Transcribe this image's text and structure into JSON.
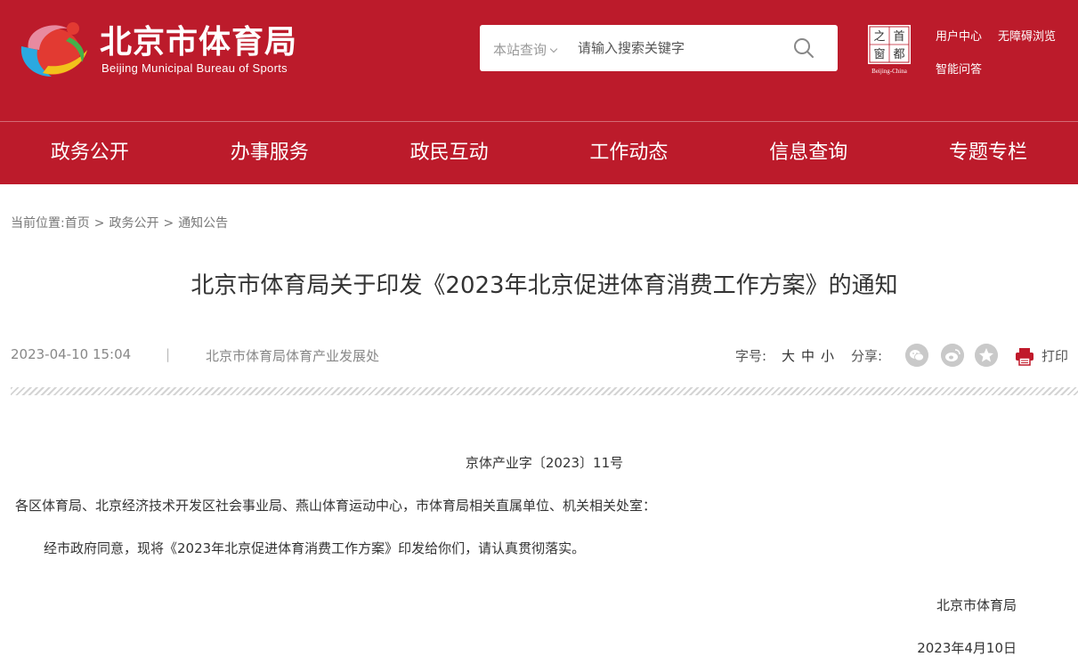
{
  "header": {
    "site_name": "北京市体育局",
    "site_name_en": "Beijing Municipal Bureau of Sports",
    "search": {
      "scope": "本站查询",
      "placeholder": "请输入搜索关键字"
    },
    "capital_window": {
      "chars": [
        "首",
        "都",
        "之",
        "窗"
      ],
      "subtitle": "Beijing-China"
    },
    "links": {
      "user_center": "用户中心",
      "accessibility": "无障碍浏览",
      "smart_qa": "智能问答"
    }
  },
  "nav": {
    "items": [
      "政务公开",
      "办事服务",
      "政民互动",
      "工作动态",
      "信息查询",
      "专题专栏"
    ]
  },
  "breadcrumb": {
    "prefix": "当前位置:",
    "items": [
      "首页",
      "政务公开",
      "通知公告"
    ],
    "separator": ">"
  },
  "article": {
    "title": "北京市体育局关于印发《2023年北京促进体育消费工作方案》的通知",
    "date": "2023-04-10 15:04",
    "divider": "|",
    "department": "北京市体育局体育产业发展处",
    "font_size_label": "字号:",
    "font_sizes": [
      "大",
      "中",
      "小"
    ],
    "share_label": "分享:",
    "print_label": "打印",
    "doc_number": "京体产业字〔2023〕11号",
    "addressee": "各区体育局、北京经济技术开发区社会事业局、燕山体育运动中心，市体育局相关直属单位、机关相关处室：",
    "body": "经市政府同意，现将《2023年北京促进体育消费工作方案》印发给你们，请认真贯彻落实。",
    "signer": "北京市体育局",
    "sign_date": "2023年4月10日"
  },
  "colors": {
    "brand_red": "#bc1b2b",
    "icon_gray": "#c9c9c9",
    "print_red": "#c0192a"
  },
  "icons": {
    "search": "search-icon",
    "share": [
      "wechat-icon",
      "weibo-icon",
      "qzone-star-icon"
    ],
    "print": "printer-icon"
  }
}
